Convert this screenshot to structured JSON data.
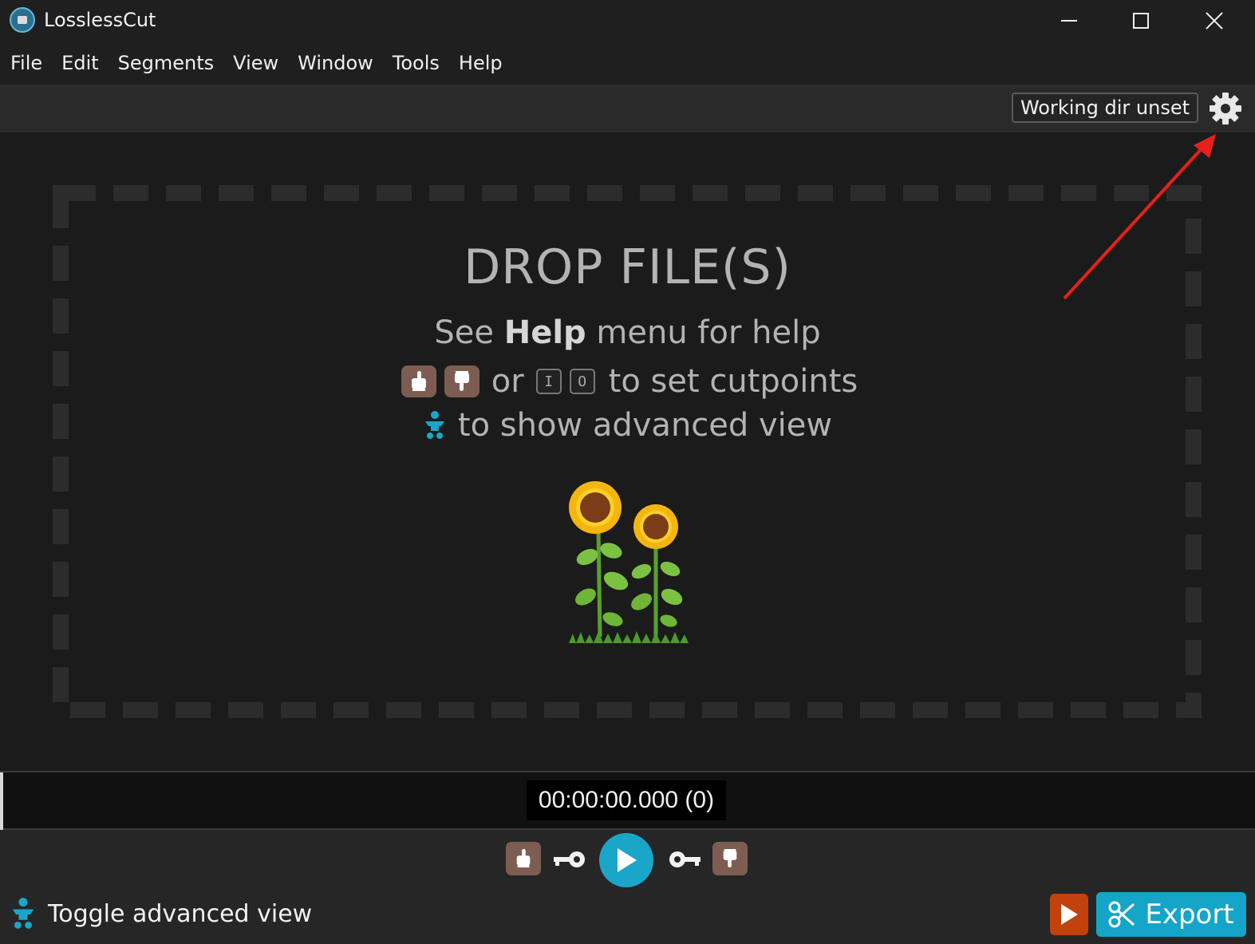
{
  "window": {
    "title": "LosslessCut"
  },
  "menu": {
    "items": [
      "File",
      "Edit",
      "Segments",
      "View",
      "Window",
      "Tools",
      "Help"
    ]
  },
  "toolbar": {
    "working_dir": "Working dir unset",
    "settings_icon": "gear-icon"
  },
  "dropzone": {
    "title": "DROP FILE(S)",
    "help_see": "See",
    "help_bold": "Help",
    "help_rest": "menu for help",
    "cut_or": "or",
    "key_in": "I",
    "key_out": "O",
    "cut_text": "to set cutpoints",
    "advanced_text": "to show advanced view"
  },
  "timeline": {
    "timecode": "00:00:00.000 (0)"
  },
  "bottom": {
    "toggle_advanced": "Toggle advanced view",
    "export": "Export"
  },
  "colors": {
    "accent": "#14a5c8",
    "export_play": "#c2410c",
    "hand_button": "#7d5d52"
  }
}
